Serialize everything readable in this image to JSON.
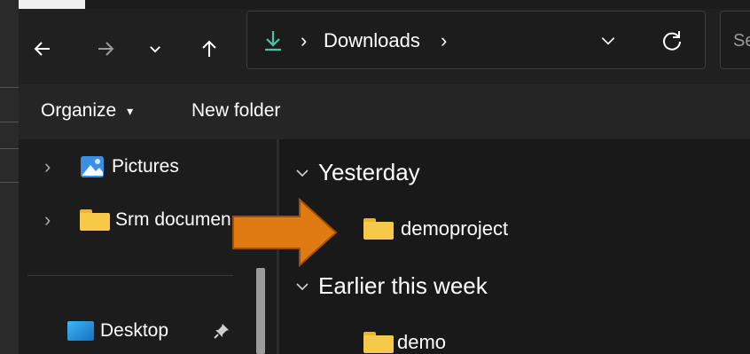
{
  "window": {
    "title": "Downloads"
  },
  "nav": {
    "back_icon": "arrow-left-icon",
    "forward_icon": "arrow-right-icon",
    "recent_icon": "chevron-down-icon",
    "up_icon": "arrow-up-icon"
  },
  "address": {
    "location_icon": "download-icon",
    "separator": "›",
    "crumbs": [
      "Downloads"
    ],
    "trailing_separator": "›",
    "dropdown_icon": "chevron-down-icon",
    "refresh_icon": "refresh-icon"
  },
  "search": {
    "placeholder_visible": "Se"
  },
  "command_bar": {
    "organize_label": "Organize",
    "organize_caret": "▾",
    "new_folder_label": "New folder"
  },
  "nav_pane": {
    "items": [
      {
        "label": "Pictures",
        "icon": "pictures-icon",
        "expand": "›"
      },
      {
        "label": "Srm documen",
        "icon": "folder-icon",
        "expand": "›"
      },
      {
        "label": "Desktop",
        "icon": "desktop-icon",
        "pinned": true
      }
    ]
  },
  "content": {
    "groups": [
      {
        "label": "Yesterday",
        "items": [
          {
            "name": "demoproject"
          }
        ]
      },
      {
        "label": "Earlier this week",
        "items": [
          {
            "name": "demo"
          }
        ]
      }
    ]
  },
  "annotation": {
    "arrow_color": "#e07b14",
    "arrow_icon": "arrow-right-callout-icon"
  },
  "colors": {
    "download_accent": "#4cc2a4",
    "folder": "#f7c948",
    "pictures": "#3a8ee6"
  }
}
